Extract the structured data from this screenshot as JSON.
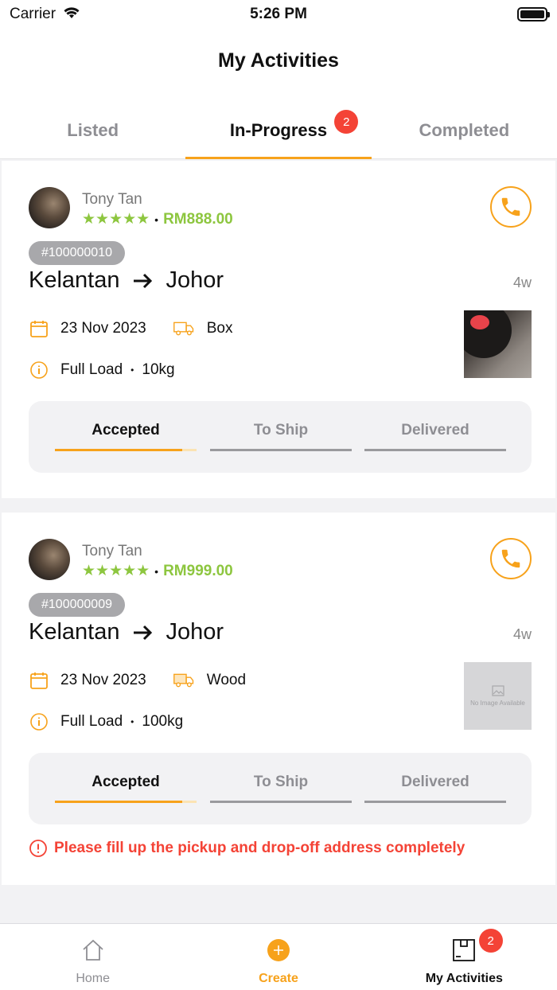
{
  "status_bar": {
    "carrier": "Carrier",
    "time": "5:26 PM"
  },
  "header": {
    "title": "My Activities"
  },
  "tabs": [
    {
      "label": "Listed",
      "active": false
    },
    {
      "label": "In-Progress",
      "active": true,
      "badge": "2"
    },
    {
      "label": "Completed",
      "active": false
    }
  ],
  "orders": [
    {
      "driver_name": "Tony Tan",
      "stars": "★★★★★",
      "dot": "•",
      "price": "RM888.00",
      "order_id": "#100000010",
      "from": "Kelantan",
      "to": "Johor",
      "age": "4w",
      "date": "23 Nov 2023",
      "cargo_type": "Box",
      "load_type": "Full Load",
      "weight": "10kg",
      "image": "photo",
      "steps": [
        "Accepted",
        "To Ship",
        "Delivered"
      ],
      "current_step": "Accepted",
      "step_progress": 0.9
    },
    {
      "driver_name": "Tony Tan",
      "stars": "★★★★★",
      "dot": "•",
      "price": "RM999.00",
      "order_id": "#100000009",
      "from": "Kelantan",
      "to": "Johor",
      "age": "4w",
      "date": "23 Nov 2023",
      "cargo_type": "Wood",
      "load_type": "Full Load",
      "weight": "100kg",
      "image_placeholder": "No Image Available",
      "steps": [
        "Accepted",
        "To Ship",
        "Delivered"
      ],
      "current_step": "Accepted",
      "step_progress": 0.9,
      "warning": "Please fill up the pickup and drop-off address completely"
    }
  ],
  "tabbar": {
    "items": [
      {
        "label": "Home",
        "icon": "home-icon"
      },
      {
        "label": "Create",
        "icon": "plus-circle-icon"
      },
      {
        "label": "My Activities",
        "icon": "package-icon",
        "badge": "2",
        "active": true
      }
    ]
  },
  "colors": {
    "accent": "#f7a21b",
    "rating_green": "#8dc63f",
    "error_red": "#f44336",
    "badge_red": "#f44336"
  }
}
